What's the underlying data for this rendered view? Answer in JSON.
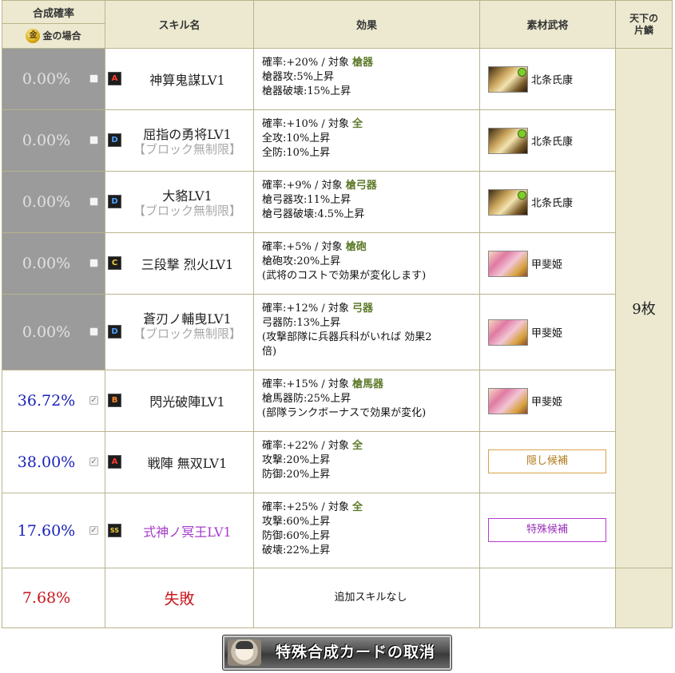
{
  "headers": {
    "probability": "合成確率",
    "gold_case": "金の場合",
    "gold_icon": "金",
    "skill_name": "スキル名",
    "effect": "効果",
    "material": "素材武将",
    "fragment": "天下の\n片鱗"
  },
  "rows": [
    {
      "pct": "0.00%",
      "checked": false,
      "rank": "A",
      "name": "神算鬼謀LV1",
      "block": "",
      "effect": {
        "prob": "確率:+20%",
        "sep": "/",
        "target_label": "対象",
        "target": "槍器",
        "lines": [
          "槍器攻:5%上昇",
          "槍器破壊:15%上昇"
        ]
      },
      "material": {
        "portrait": "hojo",
        "name": "北条氏康"
      }
    },
    {
      "pct": "0.00%",
      "checked": false,
      "rank": "D",
      "name": "屈指の勇将LV1",
      "block": "【ブロック無制限】",
      "effect": {
        "prob": "確率:+10%",
        "sep": "/",
        "target_label": "対象",
        "target": "全",
        "lines": [
          "全攻:10%上昇",
          "全防:10%上昇"
        ]
      },
      "material": {
        "portrait": "hojo",
        "name": "北条氏康"
      }
    },
    {
      "pct": "0.00%",
      "checked": false,
      "rank": "D",
      "name": "大貉LV1",
      "block": "【ブロック無制限】",
      "effect": {
        "prob": "確率:+9%",
        "sep": "/",
        "target_label": "対象",
        "target": "槍弓器",
        "lines": [
          "槍弓器攻:11%上昇",
          "槍弓器破壊:4.5%上昇"
        ]
      },
      "material": {
        "portrait": "hojo",
        "name": "北条氏康"
      }
    },
    {
      "pct": "0.00%",
      "checked": false,
      "rank": "C",
      "name": "三段撃 烈火LV1",
      "block": "",
      "effect": {
        "prob": "確率:+5%",
        "sep": "/",
        "target_label": "対象",
        "target": "槍砲",
        "lines": [
          "槍砲攻:20%上昇",
          "(武将のコストで効果が変化します)"
        ]
      },
      "material": {
        "portrait": "kai",
        "name": "甲斐姫"
      }
    },
    {
      "pct": "0.00%",
      "checked": false,
      "rank": "D",
      "name": "蒼刃ノ輔曳LV1",
      "block": "【ブロック無制限】",
      "effect": {
        "prob": "確率:+12%",
        "sep": "/",
        "target_label": "対象",
        "target": "弓器",
        "lines": [
          "弓器防:13%上昇",
          "(攻撃部隊に兵器兵科がいれば 効果2",
          "倍)"
        ]
      },
      "material": {
        "portrait": "kai",
        "name": "甲斐姫"
      }
    },
    {
      "pct": "36.72%",
      "checked": true,
      "rank": "B",
      "name": "閃光破陣LV1",
      "block": "",
      "effect": {
        "prob": "確率:+15%",
        "sep": "/",
        "target_label": "対象",
        "target": "槍馬器",
        "lines": [
          "槍馬器防:25%上昇",
          "(部隊ランクボーナスで効果が変化)"
        ]
      },
      "material": {
        "portrait": "kai",
        "name": "甲斐姫"
      }
    },
    {
      "pct": "38.00%",
      "checked": true,
      "rank": "A",
      "name": "戦陣 無双LV1",
      "block": "",
      "effect": {
        "prob": "確率:+22%",
        "sep": "/",
        "target_label": "対象",
        "target": "全",
        "lines": [
          "攻撃:20%上昇",
          "防御:20%上昇"
        ]
      },
      "material": {
        "candidate": "隠し候補",
        "special": false
      }
    },
    {
      "pct": "17.60%",
      "checked": true,
      "rank": "SS",
      "name": "式神ノ冥王LV1",
      "block": "",
      "effect": {
        "prob": "確率:+25%",
        "sep": "/",
        "target_label": "対象",
        "target": "全",
        "lines": [
          "攻撃:60%上昇",
          "防御:60%上昇",
          "破壊:22%上昇"
        ]
      },
      "material": {
        "candidate": "特殊候補",
        "special": true
      }
    }
  ],
  "fail_row": {
    "pct": "7.68%",
    "label": "失敗",
    "effect": "追加スキルなし"
  },
  "fragment_count": "9枚",
  "cancel_button": "特殊合成カードの取消",
  "checkbox_mark": "✓",
  "colors": {
    "header_bg": "#ece9d0",
    "border": "#b9b48e",
    "grey_cell": "#9b9b9b",
    "blue_pct": "#1a22b8",
    "red": "#c8161d",
    "target_green": "#5e7a2b"
  }
}
